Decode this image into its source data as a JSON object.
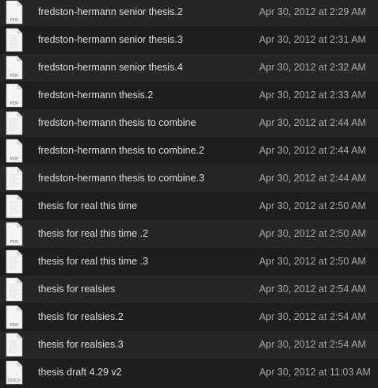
{
  "files": [
    {
      "name": "fredston-hermann senior thesis.2",
      "date": "Apr 30, 2012 at 2:29 AM",
      "icon": "pdf-icon",
      "label": "PDF"
    },
    {
      "name": "fredston-hermann senior thesis.3",
      "date": "Apr 30, 2012 at 2:31 AM",
      "icon": "document-icon",
      "label": ""
    },
    {
      "name": "fredston-hermann senior thesis.4",
      "date": "Apr 30, 2012 at 2:32 AM",
      "icon": "pdf-icon",
      "label": "PDF"
    },
    {
      "name": "fredston-hermann thesis.2",
      "date": "Apr 30, 2012 at 2:33 AM",
      "icon": "pdf-icon",
      "label": "PDF"
    },
    {
      "name": "fredston-hermann thesis to combine",
      "date": "Apr 30, 2012 at 2:44 AM",
      "icon": "document-icon",
      "label": ""
    },
    {
      "name": "fredston-hermann thesis to combine.2",
      "date": "Apr 30, 2012 at 2:44 AM",
      "icon": "pdf-icon",
      "label": "PDF"
    },
    {
      "name": "fredston-hermann thesis to combine.3",
      "date": "Apr 30, 2012 at 2:44 AM",
      "icon": "document-icon",
      "label": ""
    },
    {
      "name": "thesis for real this time",
      "date": "Apr 30, 2012 at 2:50 AM",
      "icon": "document-icon",
      "label": ""
    },
    {
      "name": "thesis for real this time .2",
      "date": "Apr 30, 2012 at 2:50 AM",
      "icon": "pdf-icon",
      "label": "PDF"
    },
    {
      "name": "thesis for real this time .3",
      "date": "Apr 30, 2012 at 2:50 AM",
      "icon": "document-icon",
      "label": ""
    },
    {
      "name": "thesis for realsies",
      "date": "Apr 30, 2012 at 2:54 AM",
      "icon": "document-icon",
      "label": ""
    },
    {
      "name": "thesis for realsies.2",
      "date": "Apr 30, 2012 at 2:54 AM",
      "icon": "pdf-icon",
      "label": "PDF"
    },
    {
      "name": "thesis for realsies.3",
      "date": "Apr 30, 2012 at 2:54 AM",
      "icon": "document-icon",
      "label": ""
    },
    {
      "name": "thesis draft 4.29 v2",
      "date": "Apr 30, 2012 at 11:03 AM",
      "icon": "docx-icon",
      "label": "DOCX"
    }
  ],
  "colors": {
    "row_odd": "#262626",
    "row_even": "#1e1e1e",
    "name_text": "#dedede",
    "date_text": "#a9a9a9"
  }
}
